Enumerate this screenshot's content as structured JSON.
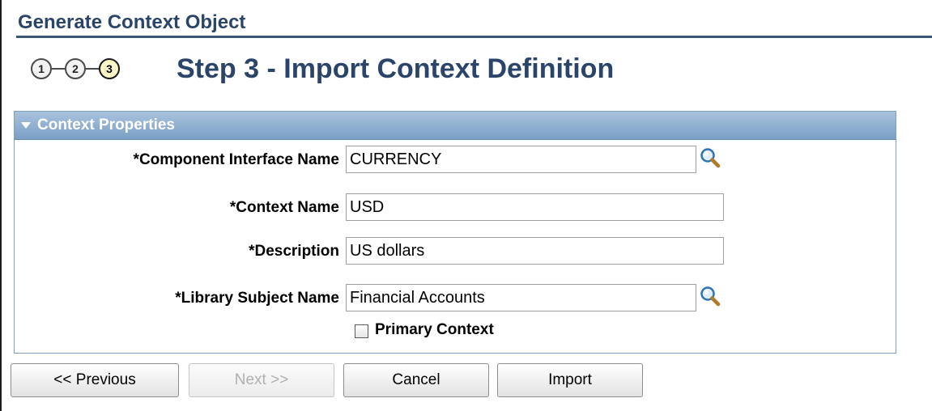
{
  "page": {
    "title": "Generate Context Object"
  },
  "steps": {
    "items": [
      "1",
      "2",
      "3"
    ],
    "current": 3,
    "title": "Step 3 - Import Context Definition"
  },
  "section": {
    "title": "Context Properties",
    "fields": {
      "component_interface": {
        "label": "*Component Interface Name",
        "value": "CURRENCY"
      },
      "context_name": {
        "label": "*Context Name",
        "value": "USD"
      },
      "description": {
        "label": "*Description",
        "value": "US dollars"
      },
      "library_subject": {
        "label": "*Library Subject Name",
        "value": "Financial Accounts"
      }
    },
    "primary_context": {
      "label": "Primary Context",
      "checked": false
    }
  },
  "buttons": {
    "previous": "<< Previous",
    "next": "Next >>",
    "cancel": "Cancel",
    "import": "Import"
  },
  "colors": {
    "header_text": "#2a4569",
    "section_header": "#7aa0c6",
    "current_step": "#fff6c8"
  },
  "icons": {
    "lookup": "magnifier-icon",
    "collapse": "triangle-down-icon"
  }
}
